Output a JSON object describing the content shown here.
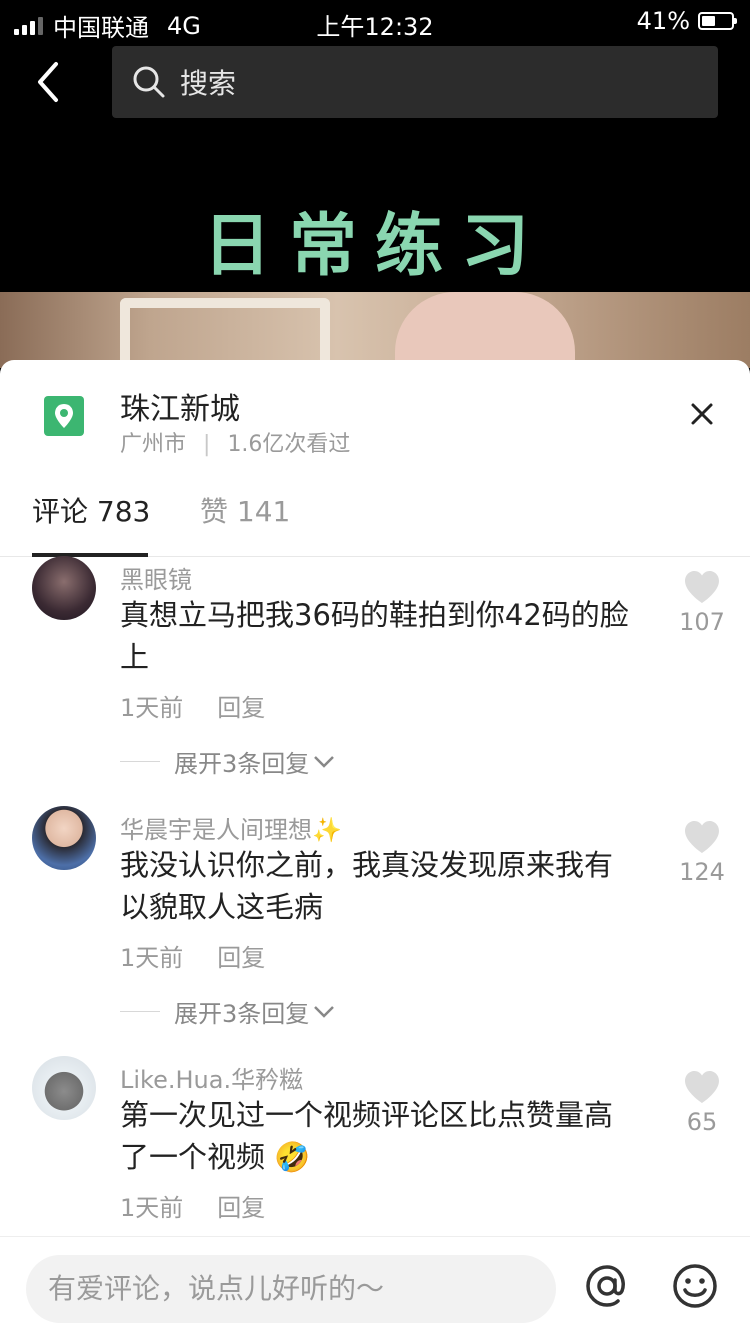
{
  "status": {
    "carrier": "中国联通",
    "network": "4G",
    "time": "上午12:32",
    "battery": "41%",
    "battery_level": 0.41
  },
  "search": {
    "placeholder": "搜索"
  },
  "video": {
    "title": "日常练习"
  },
  "location": {
    "name": "珠江新城",
    "city": "广州市",
    "views": "1.6亿次看过"
  },
  "tabs": [
    {
      "label": "评论 783"
    },
    {
      "label": "赞 141"
    }
  ],
  "comments": [
    {
      "user": "黑眼镜",
      "text": "真想立马把我36码的鞋拍到你42码的脸上",
      "time": "1天前",
      "reply": "回复",
      "likes": "107",
      "expand": "展开3条回复"
    },
    {
      "user": "华晨宇是人间理想✨",
      "text": "我没认识你之前，我真没发现原来我有以貌取人这毛病",
      "time": "1天前",
      "reply": "回复",
      "likes": "124",
      "expand": "展开3条回复"
    },
    {
      "user": "Like.Hua.华矜糍",
      "text": "第一次见过一个视频评论区比点赞量高了一个视频 🤣",
      "time": "1天前",
      "reply": "回复",
      "likes": "65"
    }
  ],
  "input": {
    "placeholder": "有爱评论，说点儿好听的～"
  },
  "colors": {
    "accent_green": "#3cb671",
    "title_green": "#8ad6b0"
  },
  "icons": {
    "back": "chevron-left-icon",
    "search": "search-icon",
    "location": "map-pin-icon",
    "close": "close-icon",
    "like": "heart-icon",
    "at": "at-icon",
    "emoji": "emoji-icon"
  }
}
